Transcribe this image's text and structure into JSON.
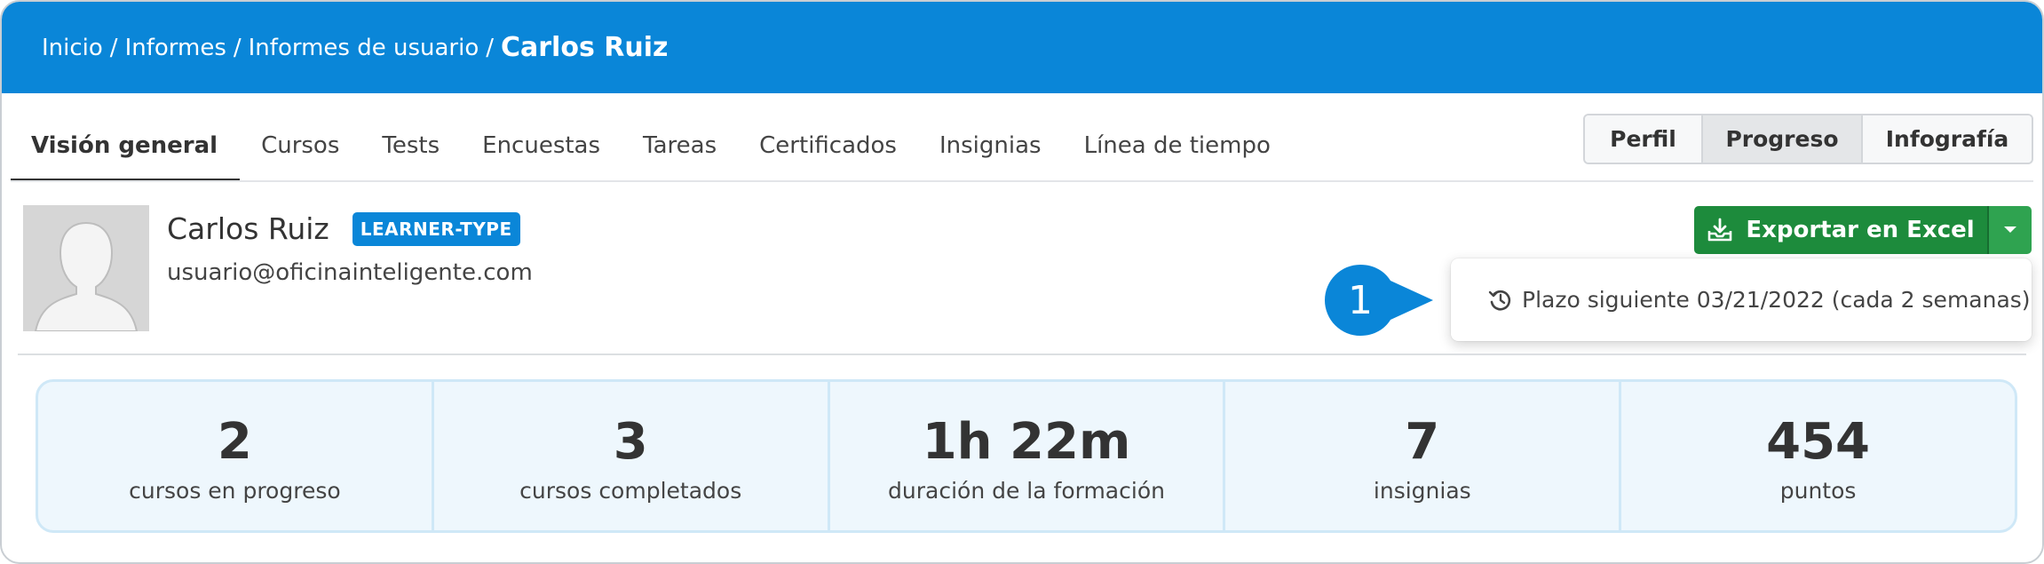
{
  "breadcrumb": {
    "items": [
      "Inicio",
      "Informes",
      "Informes de usuario"
    ],
    "separator": "/",
    "current": "Carlos Ruiz"
  },
  "tabs": [
    {
      "label": "Visión general",
      "active": true
    },
    {
      "label": "Cursos"
    },
    {
      "label": "Tests"
    },
    {
      "label": "Encuestas"
    },
    {
      "label": "Tareas"
    },
    {
      "label": "Certificados"
    },
    {
      "label": "Insignias"
    },
    {
      "label": "Línea de tiempo"
    }
  ],
  "view_switch": [
    {
      "label": "Perfil"
    },
    {
      "label": "Progreso",
      "selected": true
    },
    {
      "label": "Infografía"
    }
  ],
  "user": {
    "name": "Carlos Ruiz",
    "type_badge": "LEARNER-TYPE",
    "email": "usuario@oficinainteligente.com",
    "avatar_icon": "user-silhouette-icon"
  },
  "export": {
    "label": "Exportar en Excel",
    "icon": "download-tray-icon",
    "caret_icon": "caret-down-icon",
    "dropdown_item": "Plazo siguiente 03/21/2022 (cada 2 semanas)",
    "dropdown_icon": "history-icon"
  },
  "callout": {
    "number": "1",
    "color": "#0a86d8"
  },
  "stats": [
    {
      "value": "2",
      "label": "cursos en progreso"
    },
    {
      "value": "3",
      "label": "cursos completados"
    },
    {
      "value": "1h 22m",
      "label": "duración de la formación"
    },
    {
      "value": "7",
      "label": "insignias"
    },
    {
      "value": "454",
      "label": "puntos"
    }
  ],
  "colors": {
    "header": "#0a86d8",
    "export_button": "#1d8b3c",
    "badge": "#0a86d8",
    "stats_bg": "#eef7fd"
  }
}
